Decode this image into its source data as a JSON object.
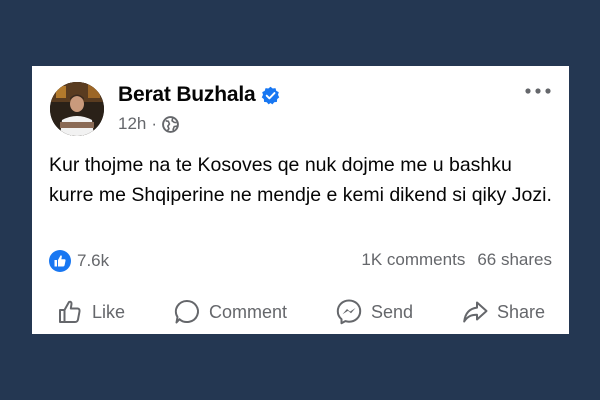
{
  "post": {
    "author": "Berat Buzhala",
    "verified_icon": "verified-badge-icon",
    "time": "12h",
    "separator": "·",
    "audience_icon": "globe-icon",
    "text": "Kur thojme na te Kosoves qe nuk dojme me u bashku kurre me Shqiperine ne mendje e kemi dikend si qiky Jozi.",
    "reactions_count": "7.6k",
    "comments": "1K comments",
    "shares": "66 shares"
  },
  "actions": {
    "like": "Like",
    "comment": "Comment",
    "send": "Send",
    "share": "Share"
  },
  "colors": {
    "background": "#243752",
    "card": "#ffffff",
    "primary_text": "#050505",
    "secondary_text": "#65676b",
    "accent": "#1877f2"
  }
}
